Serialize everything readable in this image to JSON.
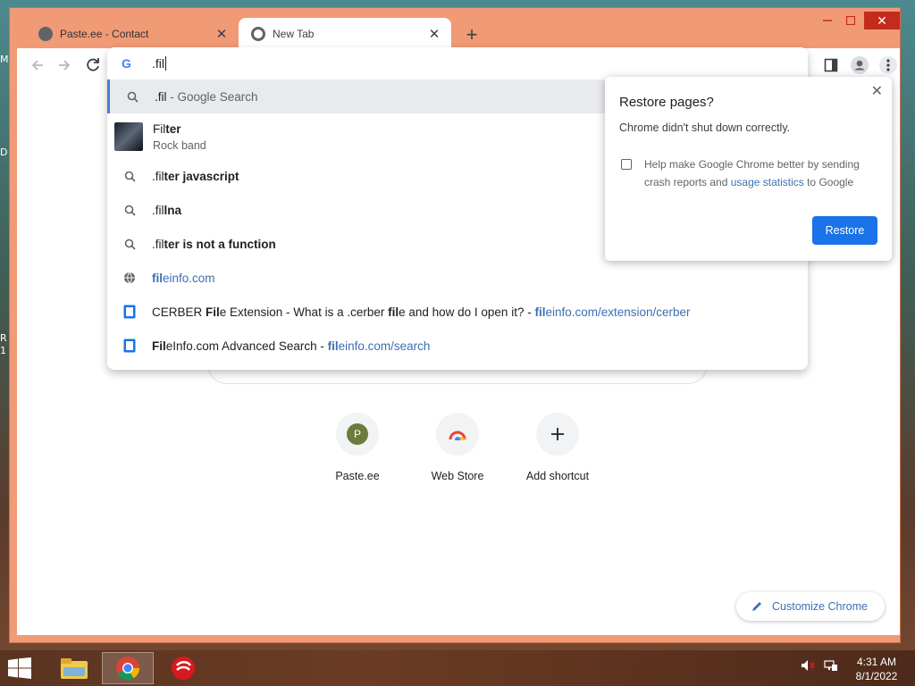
{
  "desktop": {
    "edge_labels": [
      "M",
      "D",
      "R",
      "1"
    ]
  },
  "browser": {
    "tabs": [
      {
        "title": "Paste.ee - Contact",
        "active": false,
        "favicon": "globe-icon"
      },
      {
        "title": "New Tab",
        "active": true,
        "favicon": "chrome-icon"
      }
    ],
    "new_tab_label": "+",
    "window_controls": {
      "close": "✕"
    }
  },
  "omnibox": {
    "value": ".fil",
    "suggestions": [
      {
        "type": "search",
        "icon": "search-icon",
        "prefix": ".fil",
        "suffix": " - Google Search"
      },
      {
        "type": "entity",
        "icon": "band-thumbnail",
        "bold_prefix": "Fil",
        "bold_rest": "ter",
        "subtitle": "Rock band"
      },
      {
        "type": "search",
        "icon": "search-icon",
        "prefix": ".fil",
        "bold": "ter javascript"
      },
      {
        "type": "search",
        "icon": "search-icon",
        "prefix": ".fil",
        "bold": "lna"
      },
      {
        "type": "search",
        "icon": "search-icon",
        "prefix": ".fil",
        "bold": "ter is not a function"
      },
      {
        "type": "url",
        "icon": "globe-icon",
        "bold": "fil",
        "rest": "einfo.com"
      },
      {
        "type": "page",
        "icon": "document-icon",
        "text1": "CERBER ",
        "b1": "Fil",
        "text2": "e Extension - What is a .cerber ",
        "b2": "fil",
        "text3": "e and how do I open it? - ",
        "url_bold": "fil",
        "url_rest": "einfo.com/extension/cerber"
      },
      {
        "type": "page",
        "icon": "document-icon",
        "b1": "Fil",
        "text1": "eInfo.com Advanced Search - ",
        "url_bold": "fil",
        "url_rest": "einfo.com/search"
      }
    ]
  },
  "restore_bubble": {
    "title": "Restore pages?",
    "message": "Chrome didn't shut down correctly.",
    "help_text_1": "Help make Google Chrome better by sending crash reports and ",
    "help_link": "usage statistics",
    "help_text_2": " to Google",
    "button": "Restore",
    "close": "✕"
  },
  "shortcuts": [
    {
      "label": "Paste.ee",
      "avatar": "P"
    },
    {
      "label": "Web Store",
      "icon": "webstore-icon"
    },
    {
      "label": "Add shortcut",
      "icon": "plus-icon"
    }
  ],
  "customize": {
    "label": "Customize Chrome",
    "icon": "pencil-icon"
  },
  "taskbar": {
    "apps": [
      "file-explorer-icon",
      "chrome-icon",
      "trend-micro-icon"
    ],
    "time": "4:31 AM",
    "date": "8/1/2022"
  },
  "colors": {
    "accent": "#1a73e8",
    "link": "#3c6fb4",
    "frame": "#f09a76"
  }
}
